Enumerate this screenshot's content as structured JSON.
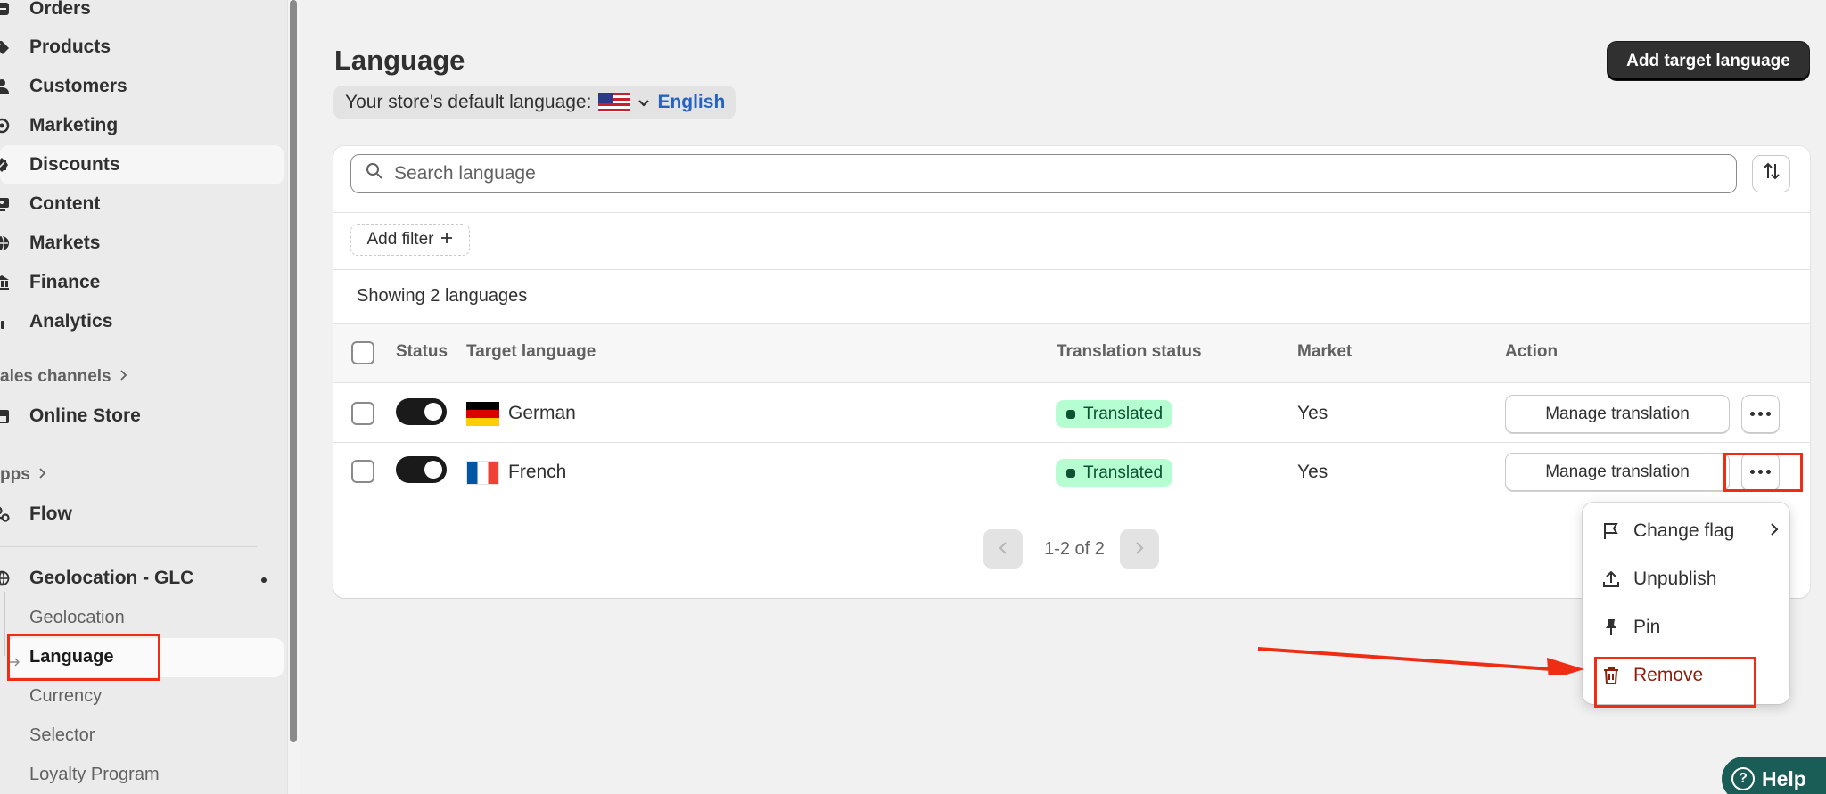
{
  "sidebar": {
    "items": [
      {
        "label": "Orders",
        "icon": "orders-icon"
      },
      {
        "label": "Products",
        "icon": "tag-icon"
      },
      {
        "label": "Customers",
        "icon": "person-icon"
      },
      {
        "label": "Marketing",
        "icon": "target-icon"
      },
      {
        "label": "Discounts",
        "icon": "discount-icon"
      },
      {
        "label": "Content",
        "icon": "content-icon"
      },
      {
        "label": "Markets",
        "icon": "globe-icon"
      },
      {
        "label": "Finance",
        "icon": "bank-icon"
      },
      {
        "label": "Analytics",
        "icon": "bar-chart-icon"
      }
    ],
    "sales_channels_label": "ales channels",
    "online_store_label": "Online Store",
    "apps_label": "pps",
    "flow_label": "Flow",
    "app_name": "Geolocation - GLC",
    "sub_items": [
      "Geolocation",
      "Language",
      "Currency",
      "Selector",
      "Loyalty Program"
    ]
  },
  "page": {
    "title": "Language",
    "default_language_prefix": "Your store's default language:",
    "default_language": "English",
    "add_button": "Add target language"
  },
  "table": {
    "search_placeholder": "Search language",
    "add_filter": "Add filter",
    "showing": "Showing 2 languages",
    "headers": [
      "Status",
      "Target language",
      "Translation status",
      "Market",
      "Action"
    ],
    "rows": [
      {
        "language": "German",
        "flag": "de",
        "status": "Translated",
        "market": "Yes",
        "action": "Manage translation"
      },
      {
        "language": "French",
        "flag": "fr",
        "status": "Translated",
        "market": "Yes",
        "action": "Manage translation"
      }
    ],
    "pagination": "1-2 of 2"
  },
  "menu": {
    "items": [
      "Change flag",
      "Unpublish",
      "Pin",
      "Remove"
    ]
  },
  "help_label": "Help",
  "colors": {
    "accent": "#303030",
    "link": "#2463c2",
    "success_bg": "#b4fed2",
    "danger": "#8e1f0b",
    "annotation": "#ee2d14"
  }
}
